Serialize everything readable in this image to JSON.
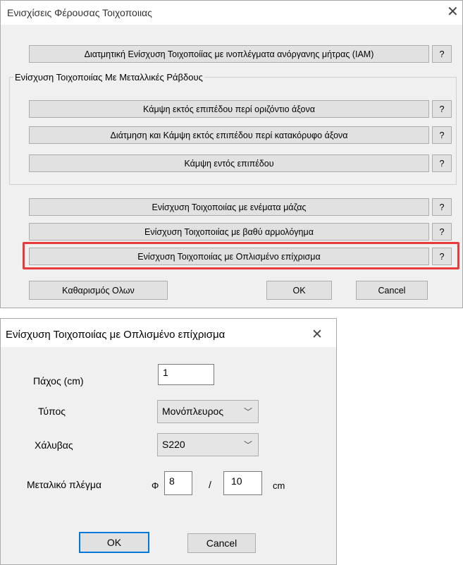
{
  "dialog1": {
    "title": "Ενισχίσεις Φέρουσας Τοιχοποιιας",
    "close": "✕",
    "top_button": "Διατμητική Ενίσχυση Τοιχοποίίας με ινοπλέγματα ανόργανης μήτρας (ΙΑΜ)",
    "group_label": "Ενίσχυση Τοιχοποιίας Με Μεταλλικές Ράβδους",
    "group_buttons": [
      "Κάμψη εκτός επιπέδου περί οριζόντιο άξονα",
      "Διάτμηση και Κάμψη εκτός επιπέδου περί κατακόρυφο άξονα",
      "Κάμψη εντός επιπέδου"
    ],
    "other_buttons": [
      "Ενίσχυση Τοιχοποιίας με ενέματα μάζας",
      "Ενίσχυση Τοιχοποιίας με βαθύ αρμολόγημα",
      "Ενίσχυση Τοιχοποιίας με Οπλισμένο επίχρισμα"
    ],
    "help": "?",
    "clear_all": "Καθαρισμός Ολων",
    "ok": "OK",
    "cancel": "Cancel",
    "highlight_color": "#e8393b"
  },
  "dialog2": {
    "title": "Ενίσχυση Τοιχοποιίας με Οπλισμένο επίχρισμα",
    "close": "✕",
    "thickness_label": "Πάχος (cm)",
    "thickness_value": "1",
    "type_label": "Τύπος",
    "type_value": "Μονόπλευρος",
    "steel_label": "Χάλυβας",
    "steel_value": "S220",
    "mesh_label": "Μεταλικό πλέγμα",
    "phi_symbol": "Φ",
    "diameter_value": "8",
    "slash": "/",
    "spacing_value": "10",
    "unit": "cm",
    "ok": "OK",
    "cancel": "Cancel",
    "chevron_icon": "chevron-down-icon",
    "default_button_color": "#0078d7"
  }
}
